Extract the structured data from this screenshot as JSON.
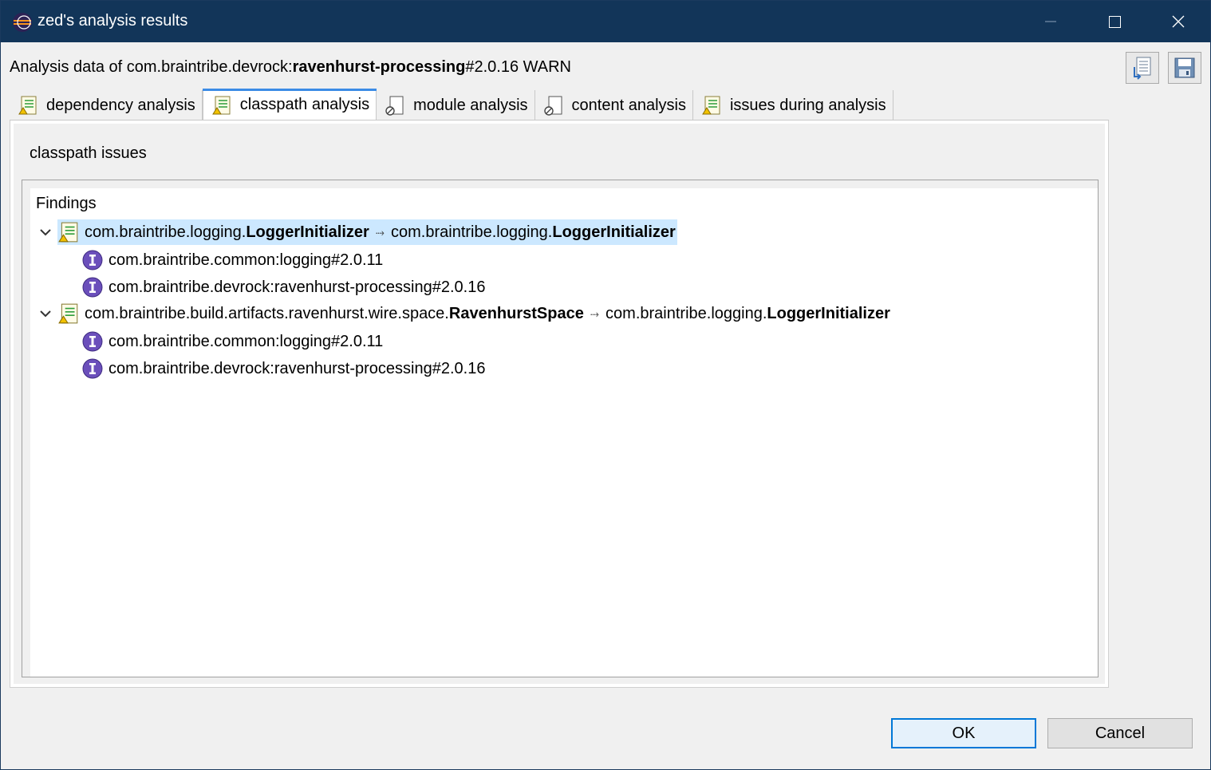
{
  "window": {
    "title": "zed's analysis results",
    "minimize_glyph": "—",
    "maximize_glyph": "☐",
    "close_glyph": "✕"
  },
  "header": {
    "prefix": "Analysis data of com.braintribe.devrock:",
    "artifact_bold": "ravenhurst-processing",
    "suffix": "#2.0.16 WARN"
  },
  "toolbar": {
    "export_icon": "export-list-icon",
    "save_icon": "save-icon"
  },
  "tabs": [
    {
      "label": "dependency analysis",
      "icon": "analysis-list-icon"
    },
    {
      "label": "classpath analysis",
      "icon": "analysis-list-icon",
      "active": true
    },
    {
      "label": "module analysis",
      "icon": "disabled-doc-icon"
    },
    {
      "label": "content analysis",
      "icon": "disabled-doc-icon"
    },
    {
      "label": "issues during analysis",
      "icon": "analysis-list-icon"
    }
  ],
  "panel": {
    "section_title": "classpath issues",
    "tree_header": "Findings",
    "findings": [
      {
        "left_prefix": "com.braintribe.logging.",
        "left_bold": "LoggerInitializer",
        "arrow": "⤑",
        "right_prefix": "com.braintribe.logging.",
        "right_bold": "LoggerInitializer",
        "selected": true,
        "children": [
          "com.braintribe.common:logging#2.0.11",
          "com.braintribe.devrock:ravenhurst-processing#2.0.16"
        ]
      },
      {
        "left_prefix": "com.braintribe.build.artifacts.ravenhurst.wire.space.",
        "left_bold": "RavenhurstSpace",
        "arrow": "⤑",
        "right_prefix": "com.braintribe.logging.",
        "right_bold": "LoggerInitializer",
        "selected": false,
        "children": [
          "com.braintribe.common:logging#2.0.11",
          "com.braintribe.devrock:ravenhurst-processing#2.0.16"
        ]
      }
    ]
  },
  "buttons": {
    "ok": "OK",
    "cancel": "Cancel"
  },
  "colors": {
    "titlebar": "#123559",
    "selection": "#cce8ff",
    "tab_accent": "#3c8ce6",
    "info_icon": "#6b4fbb"
  }
}
